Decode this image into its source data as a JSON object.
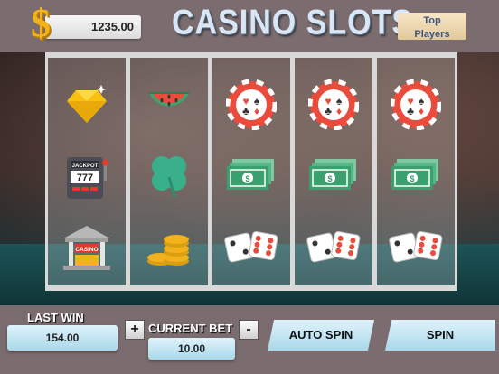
{
  "header": {
    "balance_symbol": "$",
    "balance": "1235.00",
    "title": "CASINO SLOTS",
    "top_players_line1": "Top",
    "top_players_line2": "Players"
  },
  "reels": [
    [
      "diamond-icon",
      "slot-machine-icon",
      "casino-building-icon"
    ],
    [
      "watermelon-icon",
      "clover-icon",
      "gold-coins-icon"
    ],
    [
      "poker-chip-icon",
      "cash-stack-icon",
      "dice-icon"
    ],
    [
      "poker-chip-icon",
      "cash-stack-icon",
      "dice-icon"
    ],
    [
      "poker-chip-icon",
      "cash-stack-icon",
      "dice-icon"
    ]
  ],
  "slot_machine_text": {
    "jackpot": "JACKPOT",
    "sevens": "777"
  },
  "casino_sign": "CASINO",
  "controls": {
    "last_win_label": "LAST WIN",
    "last_win_value": "154.00",
    "plus": "+",
    "minus": "-",
    "current_bet_label": "CURRENT BET",
    "current_bet_value": "10.00",
    "auto_spin_label": "AUTO SPIN",
    "spin_label": "SPIN"
  },
  "colors": {
    "accent_gold": "#f2b21b",
    "panel_blue": "#bfe4f2",
    "bar_gray": "#7b6d6f"
  }
}
